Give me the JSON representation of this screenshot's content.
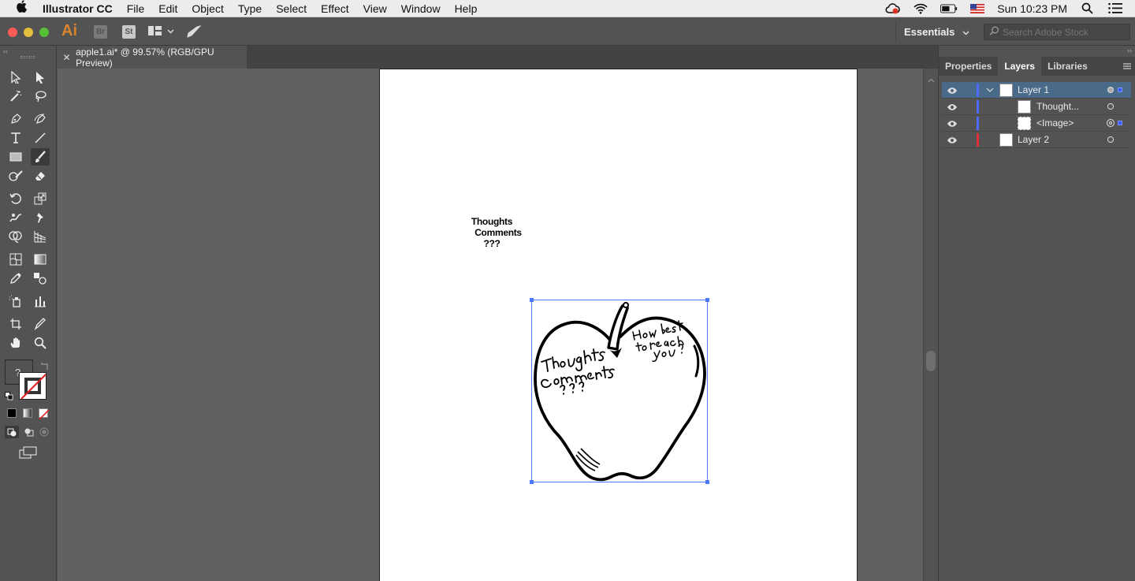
{
  "menubar": {
    "app_name": "Illustrator CC",
    "menus": [
      "File",
      "Edit",
      "Object",
      "Type",
      "Select",
      "Effect",
      "View",
      "Window",
      "Help"
    ],
    "clock": "Sun 10:23 PM"
  },
  "appbar": {
    "logo": "Ai",
    "bridge_label": "Br",
    "stock_label": "St",
    "workspace": "Essentials",
    "search_placeholder": "Search Adobe Stock"
  },
  "document": {
    "tab_title": "apple1.ai* @ 99.57% (RGB/GPU Preview)"
  },
  "artboard": {
    "text_lines": [
      "Thoughts",
      "Comments",
      "???"
    ]
  },
  "toolbar": {
    "fill_stroke_unknown": "?"
  },
  "right_panel": {
    "tabs": [
      "Properties",
      "Layers",
      "Libraries"
    ],
    "active_tab": "Layers",
    "layers": [
      {
        "name": "Layer 1",
        "color": "#4f6bff",
        "selected": true,
        "expanded": true
      },
      {
        "name": "Thought...",
        "color": "#4f6bff",
        "child": true
      },
      {
        "name": "<Image>",
        "color": "#4f6bff",
        "child": true
      },
      {
        "name": "Layer 2",
        "color": "#e0303a"
      }
    ]
  },
  "colors": {
    "accent_selection": "#4a78ff",
    "ai_orange": "#d8832e",
    "layer1_color": "#4f6bff",
    "layer2_color": "#e0303a"
  }
}
